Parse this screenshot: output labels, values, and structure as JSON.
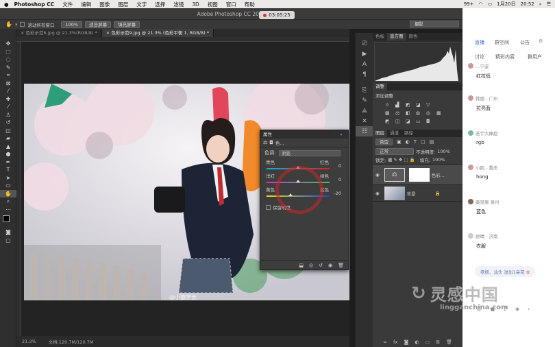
{
  "menubar": {
    "app": "Photoshop CC",
    "items": [
      "文件",
      "编辑",
      "图像",
      "图层",
      "文字",
      "选择",
      "滤镜",
      "3D",
      "视图",
      "窗口",
      "帮助"
    ],
    "status": "99+",
    "date": "1月20日",
    "time": "20:52"
  },
  "window": {
    "title": "Adobe Photoshop CC 2019",
    "timer": "03:05:25"
  },
  "options": {
    "scroll_all": "滚动所有窗口",
    "zoom": "100%",
    "fit": "适合屏幕",
    "fill": "填充屏幕",
    "workspace": "摄影"
  },
  "tabs": [
    {
      "label": "色彩示范6.jpg @ 21.3%(RGB/8) *"
    },
    {
      "label": "色彩示范9.jpg @ 21.3% (色彩平衡 1, RGB/8) *"
    }
  ],
  "status": {
    "zoom": "21.3%",
    "doc": "文档:120.7M/120.7M"
  },
  "panels": {
    "top_tabs": [
      "色板",
      "直方图",
      "颜色"
    ],
    "adjust_title": "调整",
    "adjust_add": "添加调整",
    "layers_tabs": [
      "图层",
      "通道",
      "路径"
    ],
    "kind": "类型",
    "blend": "正常",
    "opacity_label": "不透明度:",
    "opacity": "100%",
    "lock": "锁定:",
    "fill_label": "填充:",
    "fill": "100%",
    "layers": [
      {
        "name": "色彩..."
      },
      {
        "name": "背景"
      }
    ]
  },
  "props": {
    "title": "属性",
    "sub": "色...",
    "tone_label": "色调:",
    "tone": "阴影",
    "rows": [
      {
        "left": "青色",
        "right": "红色",
        "value": "0",
        "pos": 0.5
      },
      {
        "left": "洋红",
        "right": "绿色",
        "value": "0",
        "pos": 0.5
      },
      {
        "left": "黄色",
        "right": "蓝色",
        "value": "-20",
        "pos": 0.38
      }
    ],
    "preserve": "保留明度"
  },
  "canvas": {
    "caption": "@小猿学长"
  },
  "chat": {
    "tabs": [
      "直播",
      "群空间",
      "公告",
      "讨论",
      "精彩内容",
      "群用户"
    ],
    "messages": [
      {
        "user": "...宁波",
        "text": "红拉低"
      },
      {
        "user": "韩丽 - 广州",
        "text": "拉亮蓝"
      },
      {
        "user": "若宇大棒超",
        "text": "rgb"
      },
      {
        "user": "小鸥 - 重庆",
        "text": "hong"
      },
      {
        "user": "秦豆腐 泉州",
        "text": "蓝色"
      },
      {
        "user": "顾晴 - 济南",
        "text": "衣服"
      }
    ],
    "footer": "老妖、汕头 送出1朵花"
  },
  "watermark": {
    "text": "灵感中国",
    "url": "lingganchina.com"
  }
}
